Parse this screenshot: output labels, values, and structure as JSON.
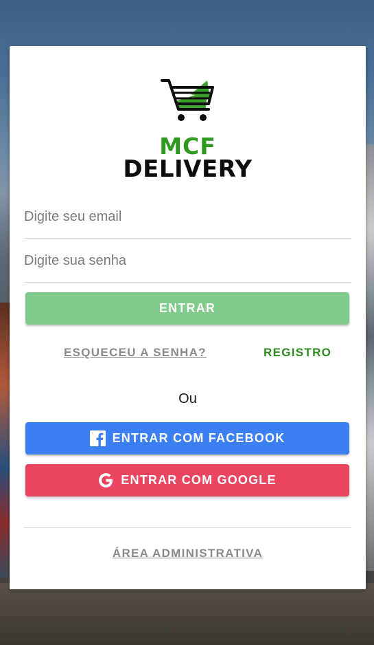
{
  "logo": {
    "brand_line1": "MCF",
    "brand_line2": "DELIVERY",
    "icon": "shopping-cart-icon"
  },
  "login": {
    "email_placeholder": "Digite seu email",
    "password_placeholder": "Digite sua senha",
    "submit_label": "ENTRAR",
    "forgot_label": "ESQUECEU A SENHA?",
    "register_label": "REGISTRO",
    "or_label": "Ou",
    "facebook_label": "ENTRAR COM FACEBOOK",
    "google_label": "ENTRAR COM GOOGLE",
    "admin_label": "ÁREA ADMINISTRATIVA"
  },
  "icons": {
    "facebook": "facebook-icon",
    "google": "google-icon"
  },
  "colors": {
    "brand_green": "#2e9a1f",
    "submit_button": "#80cb8c",
    "facebook_button": "#3b7ff2",
    "google_button": "#ea4560",
    "link_gray": "#8a8a8a"
  }
}
